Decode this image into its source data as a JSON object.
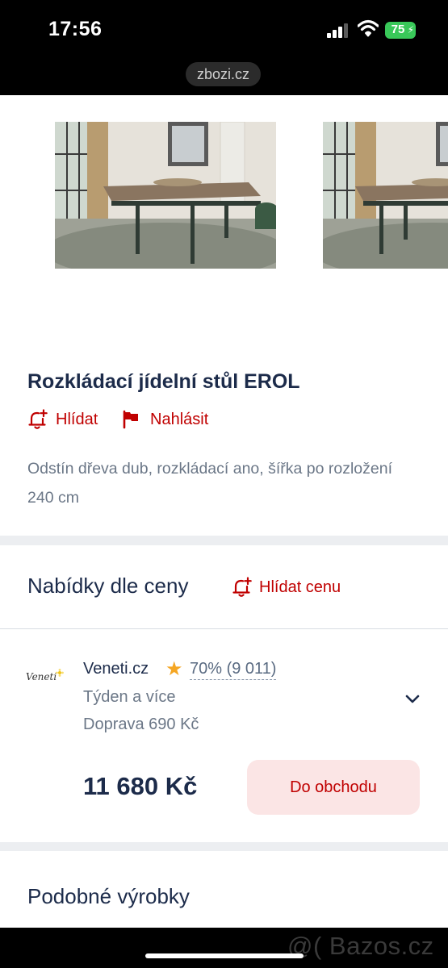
{
  "status_bar": {
    "time": "17:56",
    "battery": "75",
    "url": "zbozi.cz"
  },
  "product": {
    "title": "Rozkládací jídelní stůl EROL",
    "watch_label": "Hlídat",
    "report_label": "Nahlásit",
    "description": "Odstín dřeva dub, rozkládací ano, šířka po rozložení 240 cm"
  },
  "offers": {
    "heading": "Nabídky dle ceny",
    "watch_price_label": "Hlídat cenu",
    "items": [
      {
        "shop_logo_text": "Veneti",
        "shop_name": "Veneti.cz",
        "rating": "70% (9 011)",
        "delivery": "Týden a více",
        "shipping": "Doprava 690 Kč",
        "price": "11 680 Kč",
        "button_label": "Do obchodu"
      }
    ]
  },
  "similar": {
    "heading": "Podobné výrobky"
  },
  "watermark": "@( Bazos.cz",
  "colors": {
    "accent_red": "#c00000",
    "text_dark": "#1c2b4a",
    "text_muted": "#6b7787",
    "button_bg": "#fbe5e5",
    "star": "#f5a623"
  }
}
